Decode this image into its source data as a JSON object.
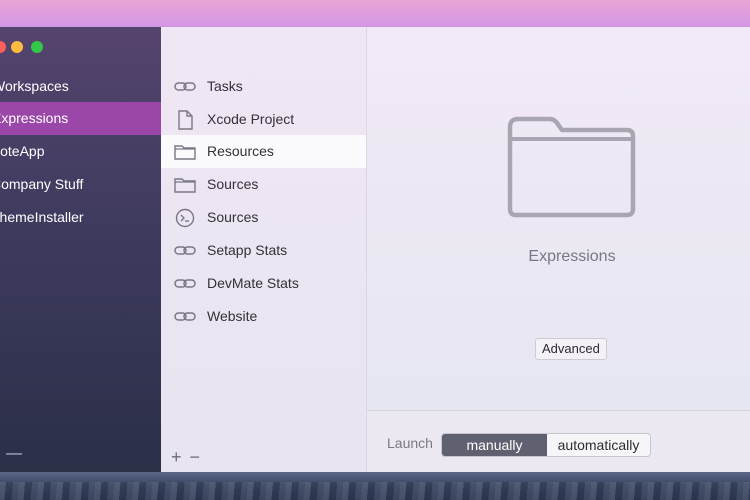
{
  "sidebar": {
    "items": [
      {
        "label": "Workspaces",
        "selected": false
      },
      {
        "label": "Expressions",
        "selected": true
      },
      {
        "label": "NoteApp",
        "selected": false
      },
      {
        "label": "Company Stuff",
        "selected": false
      },
      {
        "label": "ThemeInstaller",
        "selected": false
      }
    ],
    "footer": "—"
  },
  "list": {
    "items": [
      {
        "label": "Tasks",
        "icon": "link-icon",
        "selected": false
      },
      {
        "label": "Xcode Project",
        "icon": "document-icon",
        "selected": false
      },
      {
        "label": "Resources",
        "icon": "folder-icon",
        "selected": true
      },
      {
        "label": "Sources",
        "icon": "folder-icon",
        "selected": false
      },
      {
        "label": "Sources",
        "icon": "terminal-icon",
        "selected": false
      },
      {
        "label": "Setapp Stats",
        "icon": "link-icon",
        "selected": false
      },
      {
        "label": "DevMate Stats",
        "icon": "link-icon",
        "selected": false
      },
      {
        "label": "Website",
        "icon": "link-icon",
        "selected": false
      }
    ],
    "add": "+",
    "remove": "−"
  },
  "detail": {
    "title": "Expressions",
    "advanced_label": "Advanced",
    "launch_label": "Launch",
    "launch_options": [
      "manually",
      "automatically"
    ],
    "launch_selected": "manually"
  },
  "colors": {
    "selected_sidebar": "#9b47a9",
    "segment_active": "#5f6170"
  }
}
